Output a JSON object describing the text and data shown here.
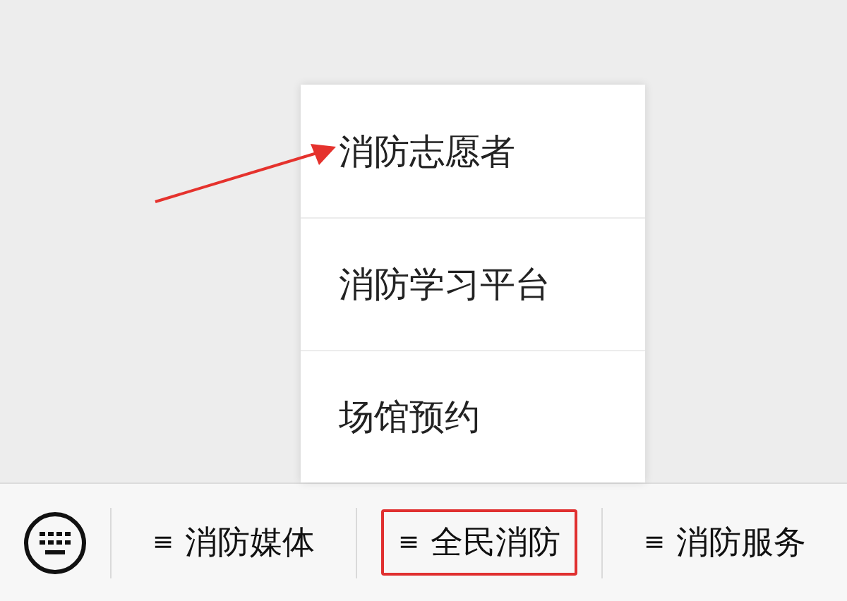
{
  "menu_bar": {
    "tabs": [
      {
        "icon": "≡",
        "label": "消防媒体",
        "highlighted": false
      },
      {
        "icon": "≡",
        "label": "全民消防",
        "highlighted": true,
        "submenu": [
          "消防志愿者",
          "消防学习平台",
          "场馆预约"
        ]
      },
      {
        "icon": "≡",
        "label": "消防服务",
        "highlighted": false
      }
    ]
  }
}
